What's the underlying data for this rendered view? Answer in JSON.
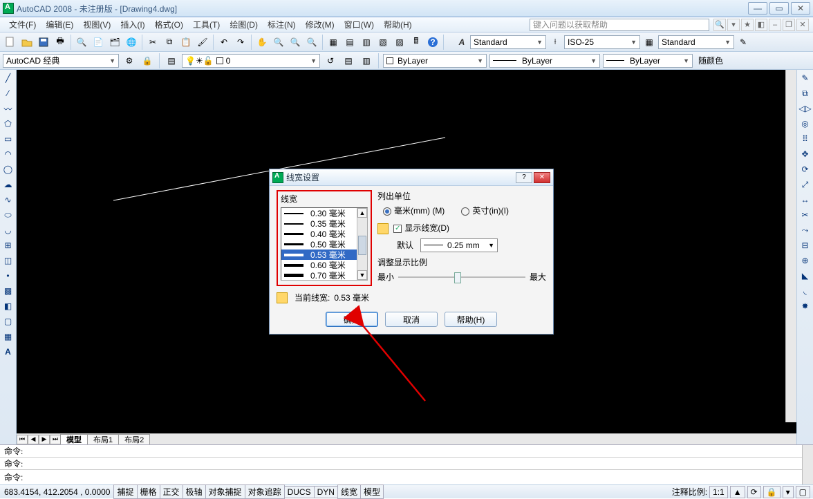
{
  "window": {
    "title": "AutoCAD 2008 - 未注册版 - [Drawing4.dwg]",
    "help_placeholder": "键入问题以获取帮助"
  },
  "menu": [
    "文件(F)",
    "编辑(E)",
    "视图(V)",
    "插入(I)",
    "格式(O)",
    "工具(T)",
    "绘图(D)",
    "标注(N)",
    "修改(M)",
    "窗口(W)",
    "帮助(H)"
  ],
  "styles": {
    "text": "Standard",
    "dim": "ISO-25",
    "table": "Standard"
  },
  "workspace": "AutoCAD 经典",
  "layer_current": "0",
  "props": {
    "color": "ByLayer",
    "ltype": "ByLayer",
    "lweight": "ByLayer",
    "plot": "随颜色"
  },
  "tabs": [
    "模型",
    "布局1",
    "布局2"
  ],
  "active_tab": 0,
  "cmd_history": [
    "命令:",
    "命令:"
  ],
  "cmd_prompt": "命令:",
  "status": {
    "coords": "683.4154,  412.2054 , 0.0000",
    "toggles": [
      "捕捉",
      "栅格",
      "正交",
      "极轴",
      "对象捕捉",
      "对象追踪",
      "DUCS",
      "DYN",
      "线宽",
      "模型"
    ],
    "annoscale_label": "注释比例:",
    "annoscale": "1:1"
  },
  "dialog": {
    "title": "线宽设置",
    "group_lineweight": "线宽",
    "lineweights": [
      {
        "label": "0.30 毫米",
        "px": 2
      },
      {
        "label": "0.35 毫米",
        "px": 2
      },
      {
        "label": "0.40 毫米",
        "px": 3
      },
      {
        "label": "0.50 毫米",
        "px": 3
      },
      {
        "label": "0.53 毫米",
        "px": 4,
        "selected": true
      },
      {
        "label": "0.60 毫米",
        "px": 4
      },
      {
        "label": "0.70 毫米",
        "px": 5
      }
    ],
    "units_label": "列出单位",
    "unit_mm": "毫米(mm) (M)",
    "unit_in": "英寸(in)(I)",
    "unit_selected": "mm",
    "show_lw": "显示线宽(D)",
    "show_lw_checked": true,
    "default_label": "默认",
    "default_value": "0.25 mm",
    "scale_label": "调整显示比例",
    "scale_min": "最小",
    "scale_max": "最大",
    "current_label": "当前线宽:",
    "current_value": "0.53 毫米",
    "btn_ok": "确定",
    "btn_cancel": "取消",
    "btn_help": "帮助(H)"
  }
}
